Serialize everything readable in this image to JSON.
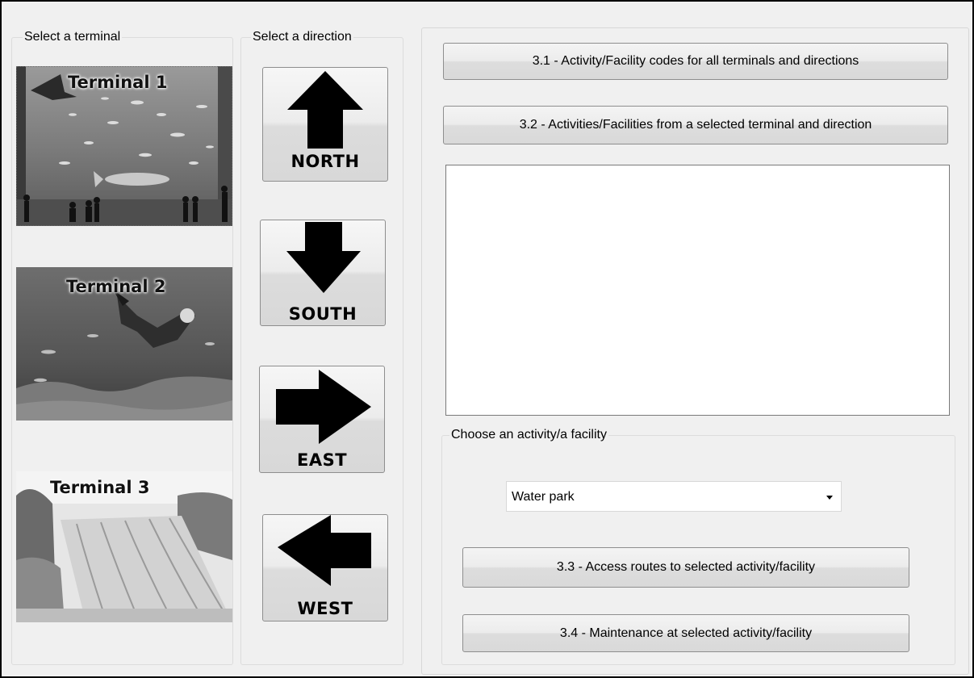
{
  "terminals": {
    "legend": "Select a terminal",
    "items": [
      {
        "label": "Terminal 1"
      },
      {
        "label": "Terminal 2"
      },
      {
        "label": "Terminal 3"
      }
    ]
  },
  "directions": {
    "legend": "Select a direction",
    "items": [
      {
        "label": "NORTH"
      },
      {
        "label": "SOUTH"
      },
      {
        "label": "EAST"
      },
      {
        "label": "WEST"
      }
    ]
  },
  "actions": {
    "btn_3_1": "3.1 - Activity/Facility codes for all terminals and directions",
    "btn_3_2": "3.2 - Activities/Facilities from a selected terminal and direction"
  },
  "activity": {
    "legend": "Choose an activity/a facility",
    "selected": "Water park",
    "btn_3_3": "3.3 - Access routes to selected activity/facility",
    "btn_3_4": "3.4 - Maintenance at selected activity/facility"
  }
}
